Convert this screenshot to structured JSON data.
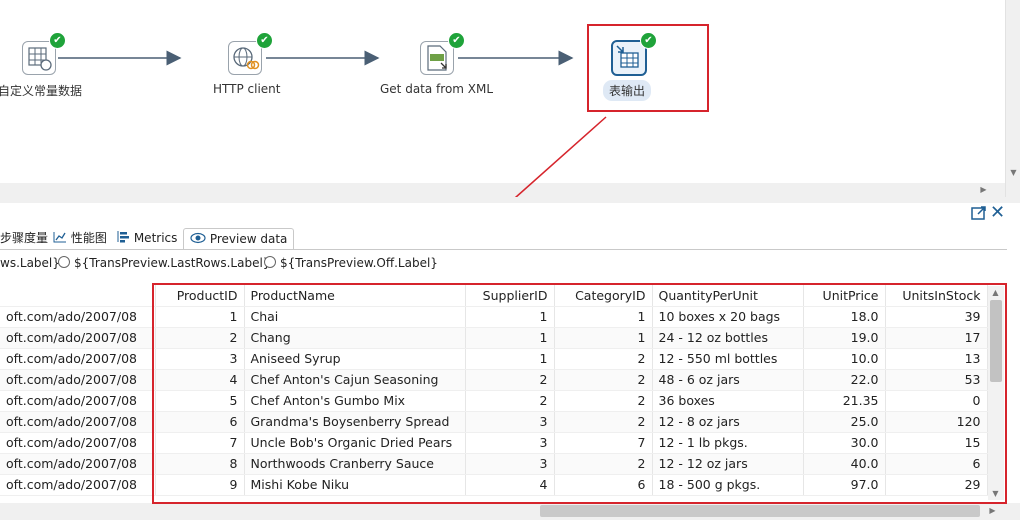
{
  "canvas": {
    "nodes": [
      {
        "label": "自定义常量数据",
        "icon": "constant-data-icon",
        "status": "success"
      },
      {
        "label": "HTTP client",
        "icon": "http-client-icon",
        "status": "success"
      },
      {
        "label": "Get data from XML",
        "icon": "xml-file-icon",
        "status": "success"
      },
      {
        "label": "表输出",
        "icon": "table-output-icon",
        "status": "success",
        "selected": true
      }
    ],
    "check_glyph": "✔"
  },
  "panel": {
    "tabs": [
      {
        "label": "步骤度量",
        "icon": "step-metrics-icon"
      },
      {
        "label": "性能图",
        "icon": "performance-chart-icon"
      },
      {
        "label": "Metrics",
        "icon": "metrics-icon"
      },
      {
        "label": "Preview data",
        "icon": "eye-icon",
        "active": true
      }
    ],
    "radios": {
      "first": "ws.Label}",
      "last_rows": "${TransPreview.LastRows.Label}",
      "off": "${TransPreview.Off.Label}"
    }
  },
  "table": {
    "columns": [
      "ProductID",
      "ProductName",
      "SupplierID",
      "CategoryID",
      "QuantityPerUnit",
      "UnitPrice",
      "UnitsInStock"
    ],
    "rows": [
      [
        "oft.com/ado/2007/08",
        "1",
        "Chai",
        "1",
        "1",
        "10 boxes x 20 bags",
        "18.0",
        "39"
      ],
      [
        "oft.com/ado/2007/08",
        "2",
        "Chang",
        "1",
        "1",
        "24 - 12 oz bottles",
        "19.0",
        "17"
      ],
      [
        "oft.com/ado/2007/08",
        "3",
        "Aniseed Syrup",
        "1",
        "2",
        "12 - 550 ml bottles",
        "10.0",
        "13"
      ],
      [
        "oft.com/ado/2007/08",
        "4",
        "Chef Anton's Cajun Seasoning",
        "2",
        "2",
        "48 - 6 oz jars",
        "22.0",
        "53"
      ],
      [
        "oft.com/ado/2007/08",
        "5",
        "Chef Anton's Gumbo Mix",
        "2",
        "2",
        "36 boxes",
        "21.35",
        "0"
      ],
      [
        "oft.com/ado/2007/08",
        "6",
        "Grandma's Boysenberry Spread",
        "3",
        "2",
        "12 - 8 oz jars",
        "25.0",
        "120"
      ],
      [
        "oft.com/ado/2007/08",
        "7",
        "Uncle Bob's Organic Dried Pears",
        "3",
        "7",
        "12 - 1 lb pkgs.",
        "30.0",
        "15"
      ],
      [
        "oft.com/ado/2007/08",
        "8",
        "Northwoods Cranberry Sauce",
        "3",
        "2",
        "12 - 12 oz jars",
        "40.0",
        "6"
      ],
      [
        "oft.com/ado/2007/08",
        "9",
        "Mishi Kobe Niku",
        "4",
        "6",
        "18 - 500 g pkgs.",
        "97.0",
        "29"
      ]
    ]
  },
  "colors": {
    "highlight_red": "#d6242c",
    "success_green": "#1fa33a",
    "hop_arrow": "#4a5f74"
  }
}
